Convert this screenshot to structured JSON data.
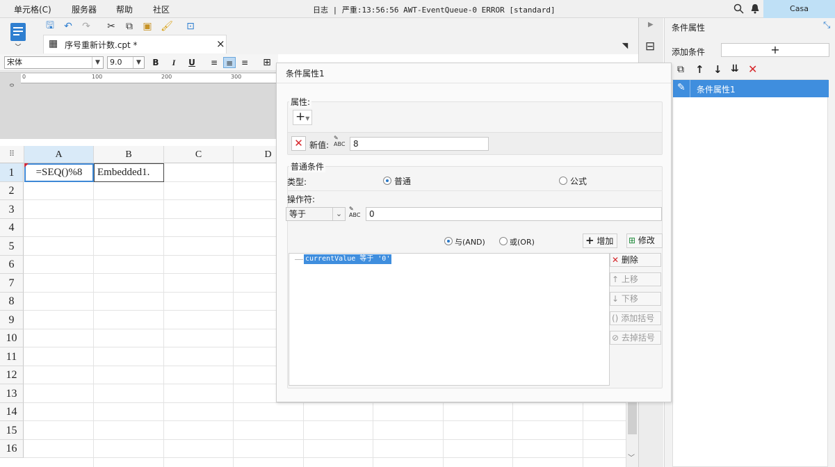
{
  "menubar": {
    "items": [
      "单元格(C)",
      "服务器",
      "帮助",
      "社区"
    ],
    "log_label": "日志",
    "log_message": "| 严重:13:56:56 AWT-EventQueue-0 ERROR [standard]",
    "user": "Casa"
  },
  "tab": {
    "title": "序号重新计数.cpt *",
    "close": "×"
  },
  "fontbar": {
    "font": "宋体",
    "size": "9.0",
    "bold": "B",
    "italic": "I",
    "underline": "U"
  },
  "ruler": {
    "ticks": [
      "0",
      "100",
      "200",
      "300"
    ]
  },
  "grid": {
    "columns": [
      "A",
      "B",
      "C",
      "D"
    ],
    "rows": [
      "1",
      "2",
      "3",
      "4",
      "5",
      "6",
      "7",
      "8",
      "9",
      "10",
      "11",
      "12",
      "13",
      "14",
      "15",
      "16"
    ],
    "cell_a1": "=SEQ()%8",
    "cell_b1": "Embedded1."
  },
  "right_panel": {
    "title": "条件属性",
    "add_label": "添加条件",
    "add_symbol": "+",
    "list": [
      "条件属性1"
    ]
  },
  "dialog": {
    "title": "条件属性1",
    "attr_group": "属性:",
    "new_value_label": "新值:",
    "new_value": "8",
    "cond_group": "普通条件",
    "type_label": "类型:",
    "type_normal": "普通",
    "type_formula": "公式",
    "operator_label": "操作符:",
    "operator_value": "等于",
    "operand_value": "0",
    "and_label": "与(AND)",
    "or_label": "或(OR)",
    "add_btn": "增加",
    "modify_btn": "修改",
    "delete_btn": "删除",
    "up_btn": "上移",
    "down_btn": "下移",
    "add_paren_btn": "添加括号",
    "remove_paren_btn": "去掉括号",
    "condition_item": "currentValue 等于 '0'"
  }
}
